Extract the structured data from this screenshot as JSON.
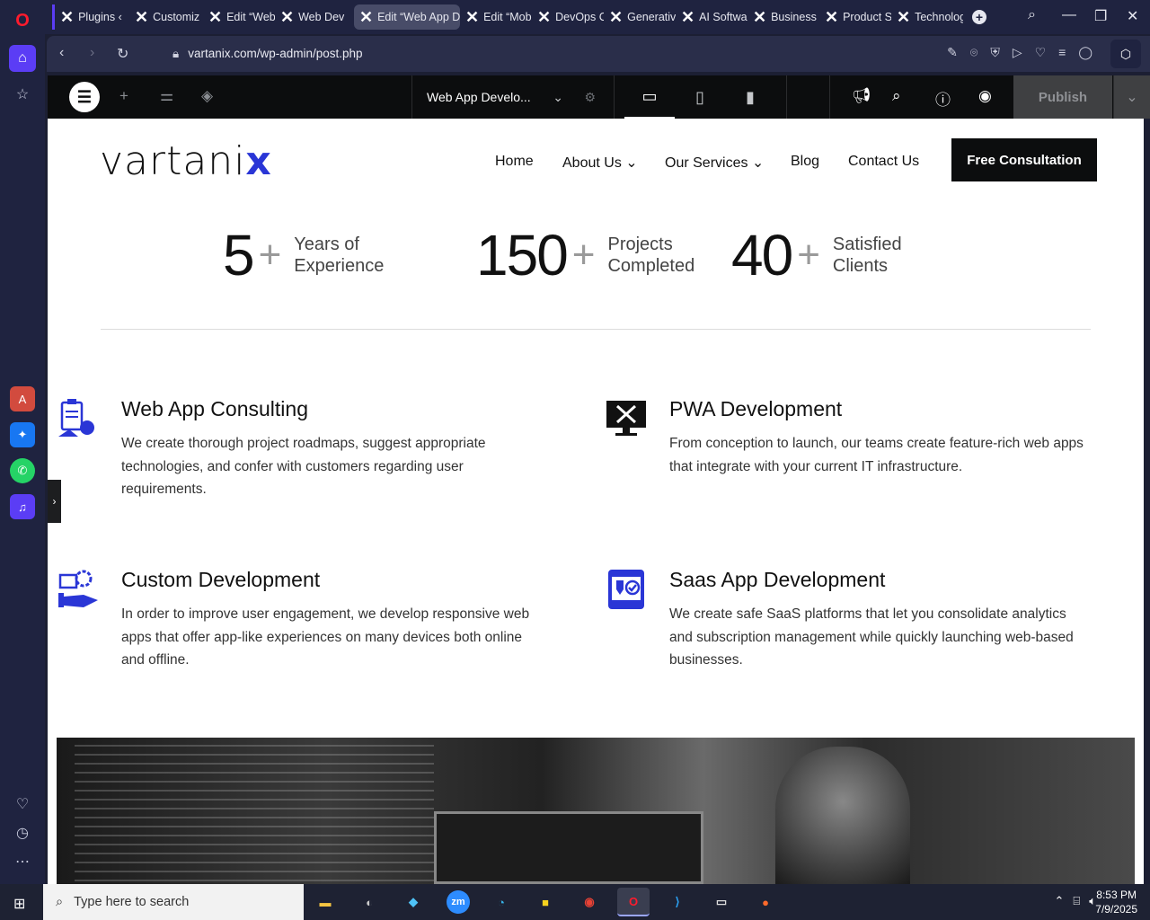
{
  "browser": {
    "tabs": [
      {
        "label": "Plugins ‹"
      },
      {
        "label": "Customiz"
      },
      {
        "label": "Edit “Web"
      },
      {
        "label": "Web Dev"
      },
      {
        "label": "Edit “Web App D"
      },
      {
        "label": "Edit “Mob"
      },
      {
        "label": "DevOps C"
      },
      {
        "label": "Generativ"
      },
      {
        "label": "AI Softwa"
      },
      {
        "label": "Business"
      },
      {
        "label": "Product S"
      },
      {
        "label": "Technolog"
      }
    ],
    "url": "vartanix.com/wp-admin/post.php"
  },
  "editor": {
    "doc_name": "Web App Develo...",
    "publish_label": "Publish"
  },
  "site": {
    "logo": "vartani",
    "logo_x": "x",
    "nav": [
      {
        "label": "Home"
      },
      {
        "label": "About Us"
      },
      {
        "label": "Our Services"
      },
      {
        "label": "Blog"
      },
      {
        "label": "Contact Us"
      }
    ],
    "cta_label": "Free Consultation",
    "stats": [
      {
        "num": "5",
        "plus": "+",
        "label": "Years of Experience"
      },
      {
        "num": "150",
        "plus": "+",
        "label": "Projects Completed"
      },
      {
        "num": "40",
        "plus": "+",
        "label": "Satisfied Clients"
      }
    ],
    "services": [
      {
        "title": "Web App Consulting",
        "desc": "We create thorough project roadmaps, suggest appropriate technologies, and confer with customers regarding user requirements."
      },
      {
        "title": "PWA Development",
        "desc": "From conception to launch, our teams create feature-rich web apps that integrate with your current IT infrastructure."
      },
      {
        "title": "Custom Development",
        "desc": "In order to improve user engagement, we develop responsive web apps that offer app-like experiences on many devices both online and offline."
      },
      {
        "title": "Saas App Development",
        "desc": "We create safe SaaS platforms that let you consolidate analytics and subscription management while quickly launching web-based businesses."
      }
    ]
  },
  "taskbar": {
    "search_placeholder": "Type here to search",
    "apps": [
      {
        "label": "zm"
      }
    ],
    "time": "8:53 PM",
    "date": "7/9/2025"
  },
  "colors": {
    "accent": "#2a36d6",
    "opera_red": "#ff1b2d",
    "opera_home": "#5b3df5"
  }
}
